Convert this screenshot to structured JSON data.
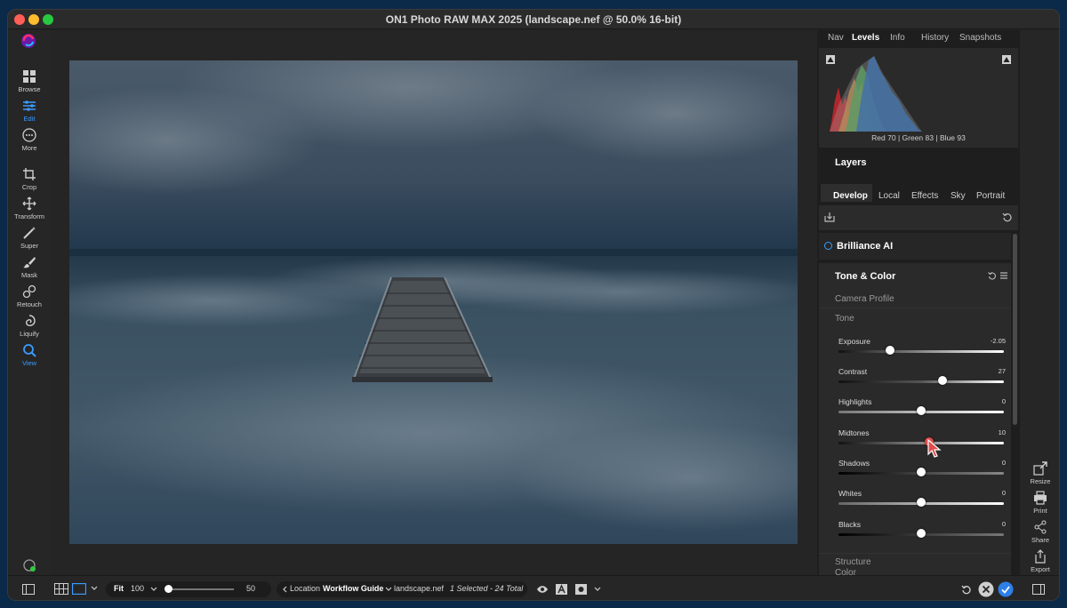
{
  "window": {
    "title": "ON1 Photo RAW MAX 2025 (landscape.nef @ 50.0% 16-bit)"
  },
  "left_tools": [
    {
      "label": "Browse",
      "icon": "grid-icon"
    },
    {
      "label": "Edit",
      "icon": "sliders-icon",
      "active": true
    },
    {
      "label": "More",
      "icon": "more-icon"
    },
    {
      "label": "Crop",
      "icon": "crop-icon"
    },
    {
      "label": "Transform",
      "icon": "move-icon"
    },
    {
      "label": "Super",
      "icon": "wand-icon"
    },
    {
      "label": "Mask",
      "icon": "brush-icon"
    },
    {
      "label": "Retouch",
      "icon": "retouch-icon"
    },
    {
      "label": "Liquify",
      "icon": "liquify-icon"
    },
    {
      "label": "View",
      "icon": "zoom-icon",
      "active": true
    }
  ],
  "top_tabs": [
    "Nav",
    "Levels",
    "Info",
    "History",
    "Snapshots"
  ],
  "top_tabs_selected": "Levels",
  "histogram": {
    "red_label": "Red",
    "red": "70",
    "green_label": "| Green",
    "green": "83",
    "blue_label": "| Blue",
    "blue": "93"
  },
  "layers": {
    "title": "Layers"
  },
  "dev_tabs": [
    "Develop",
    "Local",
    "Effects",
    "Sky",
    "Portrait"
  ],
  "dev_tabs_selected": "Develop",
  "brilliance": {
    "label": "Brilliance AI"
  },
  "tone_color": {
    "title": "Tone & Color",
    "camera_profile": "Camera Profile",
    "tone": "Tone",
    "sliders": [
      {
        "label": "Exposure",
        "value": "-2.05",
        "fraction": 0.31
      },
      {
        "label": "Contrast",
        "value": "27",
        "fraction": 0.63
      },
      {
        "label": "Highlights",
        "value": "0",
        "fraction": 0.5
      },
      {
        "label": "Midtones",
        "value": "10",
        "fraction": 0.55
      },
      {
        "label": "Shadows",
        "value": "0",
        "fraction": 0.5
      },
      {
        "label": "Whites",
        "value": "0",
        "fraction": 0.5
      },
      {
        "label": "Blacks",
        "value": "0",
        "fraction": 0.5
      }
    ],
    "structure": "Structure",
    "color": "Color"
  },
  "right_tools": [
    {
      "label": "Resize",
      "icon": "resize-icon"
    },
    {
      "label": "Print",
      "icon": "print-icon"
    },
    {
      "label": "Share",
      "icon": "share-icon"
    },
    {
      "label": "Export",
      "icon": "export-icon"
    }
  ],
  "bottom": {
    "fit": "Fit",
    "zoom": "100",
    "size_value": "50",
    "size_fraction": 0.02,
    "location": "Location",
    "workflow": "Workflow Guide",
    "filename": "landscape.nef",
    "selection": "1 Selected - 24 Total"
  },
  "colors": {
    "accent": "#3b9cff",
    "midtones_knob": "#e24b4b"
  }
}
